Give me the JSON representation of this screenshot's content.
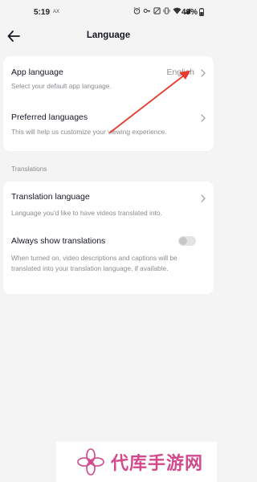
{
  "status_bar": {
    "time": "5:19",
    "carrier": "AX",
    "battery": "49%"
  },
  "header": {
    "title": "Language"
  },
  "app_language": {
    "title": "App language",
    "value": "English",
    "description": "Select your default app language."
  },
  "preferred_languages": {
    "title": "Preferred languages",
    "description": "This will help us customize your viewing experience."
  },
  "translations": {
    "section_label": "Translations",
    "translation_language": {
      "title": "Translation language",
      "description": "Language you'd like to have videos translated into."
    },
    "always_show": {
      "title": "Always show translations",
      "description": "When turned on, video descriptions and captions will be translated into your translation language, if available.",
      "enabled": false
    }
  },
  "watermark": {
    "text": "代库手游网"
  },
  "colors": {
    "background": "#f4f4f4",
    "card": "#ffffff",
    "annotation_arrow": "#e8392e",
    "watermark": "#d24a8c"
  }
}
